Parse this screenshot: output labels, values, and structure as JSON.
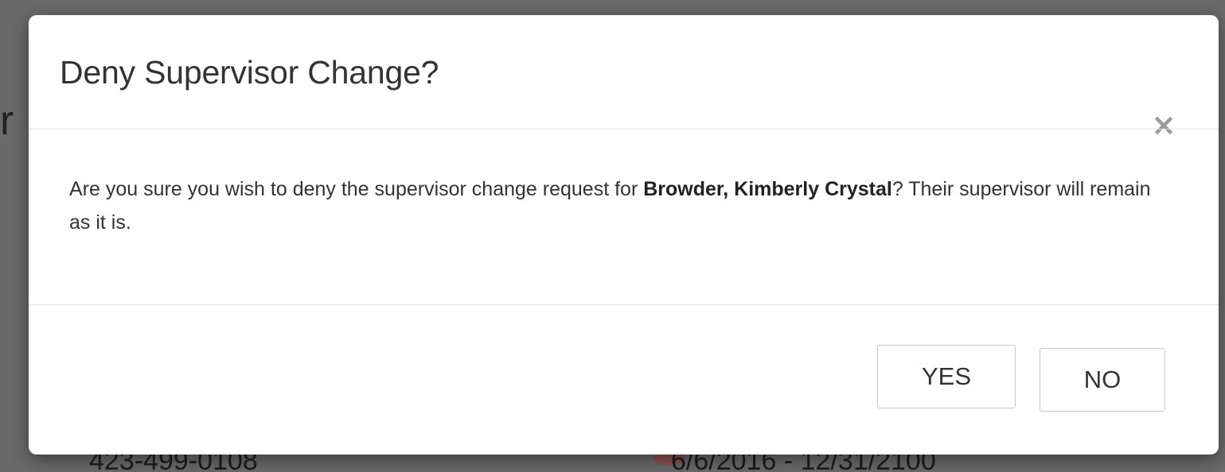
{
  "background": {
    "partial_heading_letter": "r",
    "row_phone": "423-499-0108",
    "row_dates": "6/6/2016 - 12/31/2100"
  },
  "modal": {
    "title": "Deny Supervisor Change?",
    "close_glyph": "×",
    "close_icon": "close-icon",
    "body": {
      "text_before": "Are you sure you wish to deny the supervisor change request for ",
      "employee_name": "Browder, Kimberly Crystal",
      "text_after": "? Their supervisor will remain as it is."
    },
    "buttons": {
      "yes_label": "YES",
      "no_label": "NO"
    }
  },
  "colors": {
    "overlay": "#6a6a6a",
    "modal_bg": "#ffffff",
    "text": "#333333",
    "divider": "#e3e3e3",
    "button_border": "#c8c8c8",
    "close_icon": "#9a9a9a"
  }
}
